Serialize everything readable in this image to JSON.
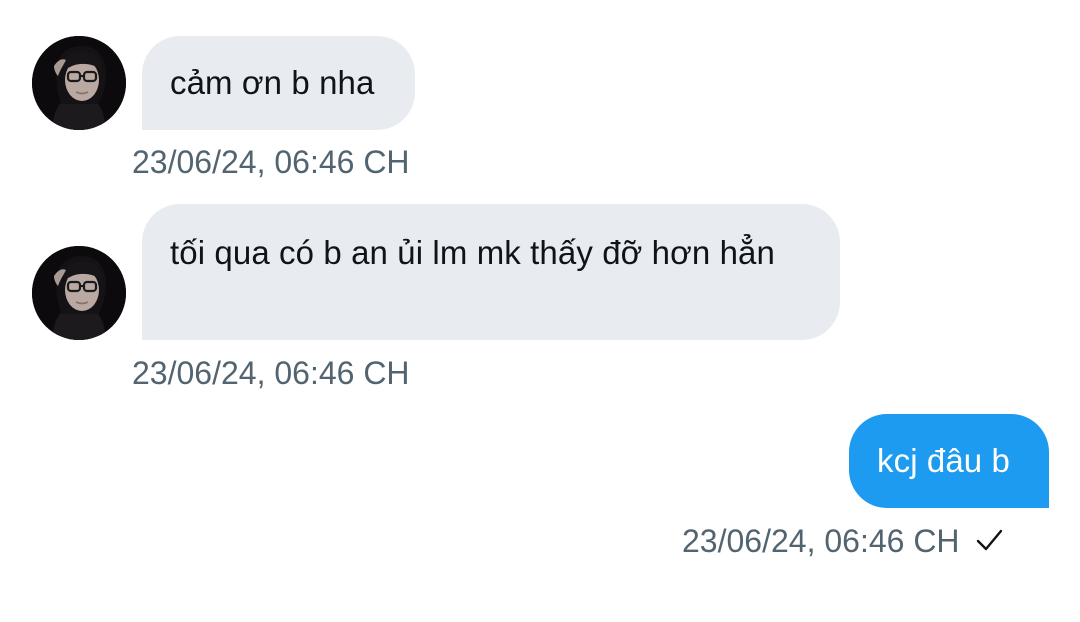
{
  "conversation": {
    "messages": [
      {
        "direction": "incoming",
        "text": "cảm ơn b nha",
        "timestamp": "23/06/24, 06:46 CH",
        "avatar_icon": "user-avatar-photo"
      },
      {
        "direction": "incoming",
        "text": "tối qua có b an ủi lm mk thấy đỡ hơn hẳn",
        "timestamp": "23/06/24, 06:46 CH",
        "avatar_icon": "user-avatar-photo"
      },
      {
        "direction": "outgoing",
        "text": "kcj đâu b",
        "timestamp": "23/06/24, 06:46 CH",
        "status_icon": "check-icon"
      }
    ]
  },
  "colors": {
    "incoming_bubble": "#e8ecf0",
    "outgoing_bubble": "#1d9bf0",
    "timestamp_text": "#536471",
    "primary_text": "#0f1419"
  }
}
